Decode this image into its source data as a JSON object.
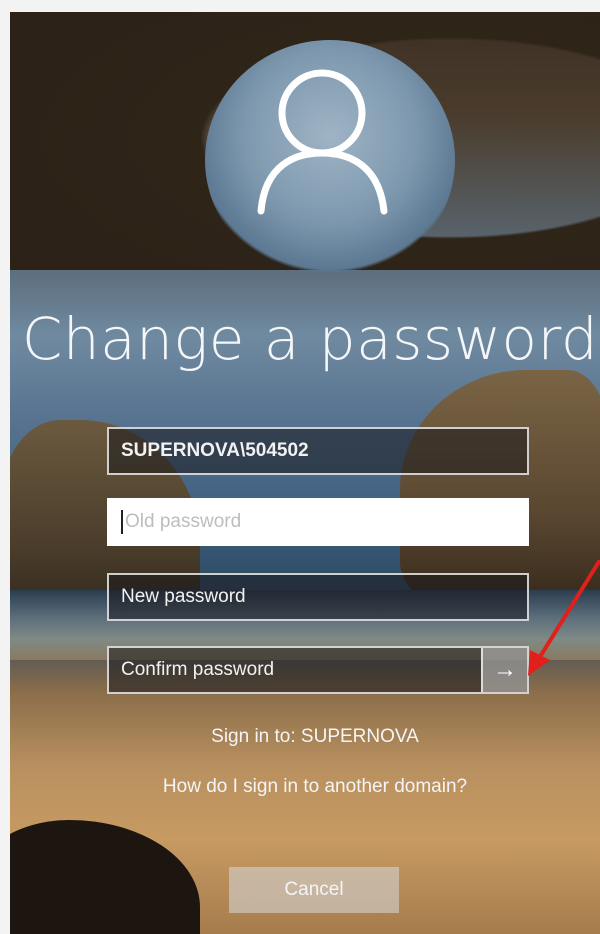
{
  "title": "Change a password",
  "fields": {
    "username": "SUPERNOVA\\504502",
    "old_password_placeholder": "Old password",
    "new_password_placeholder": "New password",
    "confirm_password_placeholder": "Confirm password"
  },
  "submit_icon": "arrow-right-icon",
  "sign_in_to": "Sign in to: SUPERNOVA",
  "other_domain_link": "How do I sign in to another domain?",
  "cancel_label": "Cancel",
  "colors": {
    "annotation_arrow": "#e0201a",
    "field_border": "#ebebeb",
    "text": "#f4f6f8"
  }
}
